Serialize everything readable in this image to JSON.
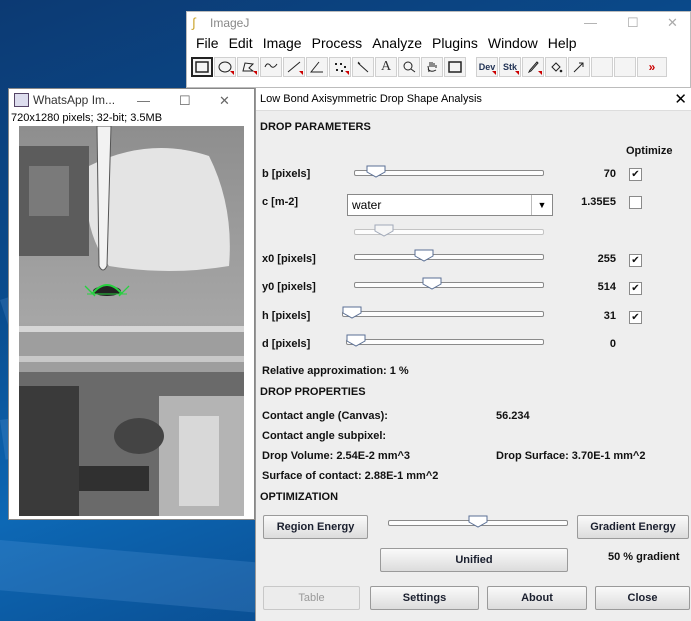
{
  "imagej": {
    "title": "ImageJ",
    "menu": [
      "File",
      "Edit",
      "Image",
      "Process",
      "Analyze",
      "Plugins",
      "Window",
      "Help"
    ],
    "tools": [
      "rectangle-tool",
      "oval-tool",
      "polygon-tool",
      "freehand-tool",
      "line-tool",
      "angle-tool",
      "point-tool",
      "wand-tool",
      "text-tool",
      "magnifier-tool",
      "hand-tool",
      "color-picker-tool"
    ],
    "tool_dev": "Dev",
    "tool_stk": "Stk",
    "more": "»"
  },
  "image_window": {
    "title": "WhatsApp Im...",
    "info": "720x1280 pixels; 32-bit; 3.5MB"
  },
  "dialog": {
    "title": "Low Bond Axisymmetric Drop Shape Analysis",
    "drop_parameters_header": "DROP PARAMETERS",
    "optimize_header": "Optimize",
    "params": [
      {
        "label": "b [pixels]",
        "value": "70",
        "checked": true,
        "slider": 0.07
      },
      {
        "label": "c [m-2]",
        "value": "1.35E5",
        "checked": false
      },
      {
        "label": "x0 [pixels]",
        "value": "255",
        "checked": true,
        "slider": 0.35
      },
      {
        "label": "y0 [pixels]",
        "value": "514",
        "checked": true,
        "slider": 0.4
      },
      {
        "label": "h [pixels]",
        "value": "31",
        "checked": true,
        "slider": 0.0
      },
      {
        "label": "d [pixels]",
        "value": "0",
        "checked": null,
        "slider": 0.0
      }
    ],
    "c_combo": "water",
    "c_slider": 0.12,
    "relative_approx": "Relative approximation: 1 %",
    "drop_properties_header": "DROP PROPERTIES",
    "contact_angle_canvas_label": "Contact angle (Canvas):",
    "contact_angle_canvas_value": "56.234",
    "contact_angle_subpixel_label": "Contact angle subpixel:",
    "drop_volume": "Drop Volume: 2.54E-2 mm^3",
    "drop_surface": "Drop Surface: 3.70E-1 mm^2",
    "surface_of_contact": "Surface of contact: 2.88E-1 mm^2",
    "optimization_header": "OPTIMIZATION",
    "region_energy": "Region Energy",
    "gradient_energy": "Gradient Energy",
    "energy_slider": 0.5,
    "unified": "Unified",
    "gradient_percent": "50 % gradient",
    "table": "Table",
    "settings": "Settings",
    "about": "About",
    "close": "Close"
  }
}
